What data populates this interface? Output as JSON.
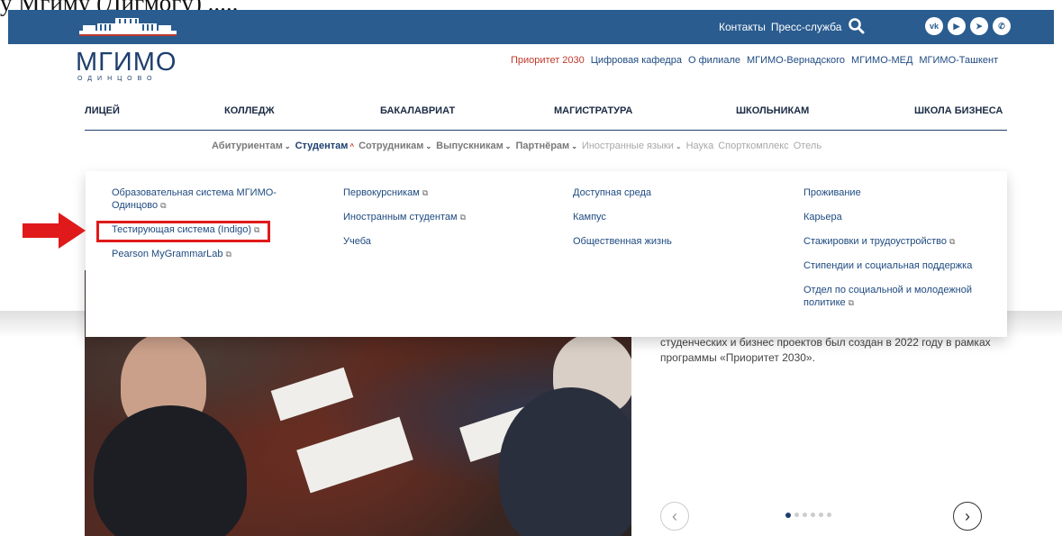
{
  "page_heading_partial": "у Мгиму (Дигмогу) .....",
  "topbar": {
    "links": [
      "Контакты",
      "Пресс-служба"
    ],
    "search_icon": "search-icon",
    "social_icons": [
      "vk-icon",
      "youtube-icon",
      "telegram-icon",
      "whatsapp-icon"
    ],
    "bg_color": "#2a5c8f"
  },
  "brand": {
    "name": "МГИМО",
    "sub": "ОДИНЦОВО"
  },
  "top_links": [
    {
      "label": "Приоритет 2030",
      "highlight": true
    },
    {
      "label": "Цифровая кафедра"
    },
    {
      "label": "О филиале"
    },
    {
      "label": "МГИМО-Вернадского"
    },
    {
      "label": "МГИМО-МЕД"
    },
    {
      "label": "МГИМО-Ташкент"
    }
  ],
  "main_nav": [
    "ЛИЦЕЙ",
    "КОЛЛЕДЖ",
    "БАКАЛАВРИАТ",
    "МАГИСТРАТУРА",
    "ШКОЛЬНИКАМ",
    "ШКОЛА БИЗНЕСА"
  ],
  "sub_nav": [
    {
      "label": "Абитуриентам",
      "chevron": "down"
    },
    {
      "label": "Студентам",
      "chevron": "up",
      "active": true
    },
    {
      "label": "Сотрудникам",
      "chevron": "down"
    },
    {
      "label": "Выпускникам",
      "chevron": "down"
    },
    {
      "label": "Партнёрам",
      "chevron": "down"
    },
    {
      "label": "Иностранные языки",
      "chevron": "down"
    },
    {
      "label": "Наука"
    },
    {
      "label": "Спорткомплекс"
    },
    {
      "label": "Отель"
    }
  ],
  "dropdown": {
    "col1": [
      {
        "label": "Образовательная система МГИМО-Одинцово",
        "external": true
      },
      {
        "label": "Тестирующая система (Indigo)",
        "external": true,
        "highlighted": true
      },
      {
        "label": "Pearson MyGrammarLab",
        "external": true
      }
    ],
    "col2": [
      {
        "label": "Первокурсникам",
        "external": true
      },
      {
        "label": "Иностранным студентам",
        "external": true
      },
      {
        "label": "Учеба"
      }
    ],
    "col3": [
      {
        "label": "Доступная среда"
      },
      {
        "label": "Кампус"
      },
      {
        "label": "Общественная жизнь"
      }
    ],
    "col4": [
      {
        "label": "Проживание"
      },
      {
        "label": "Карьера"
      },
      {
        "label": "Стажировки и трудоустройство",
        "external": true
      },
      {
        "label": "Стипендии и социальная поддержка"
      },
      {
        "label": "Отдел по социальной и молодежной политике",
        "external": true
      }
    ]
  },
  "hero": {
    "text": "студенческих и бизнес проектов был создан в 2022 году в рамках программы «Приоритет 2030».",
    "slides": 6,
    "active_slide": 1
  },
  "colors": {
    "accent": "#1e3f6e",
    "annotation_red": "#e01a1a"
  }
}
